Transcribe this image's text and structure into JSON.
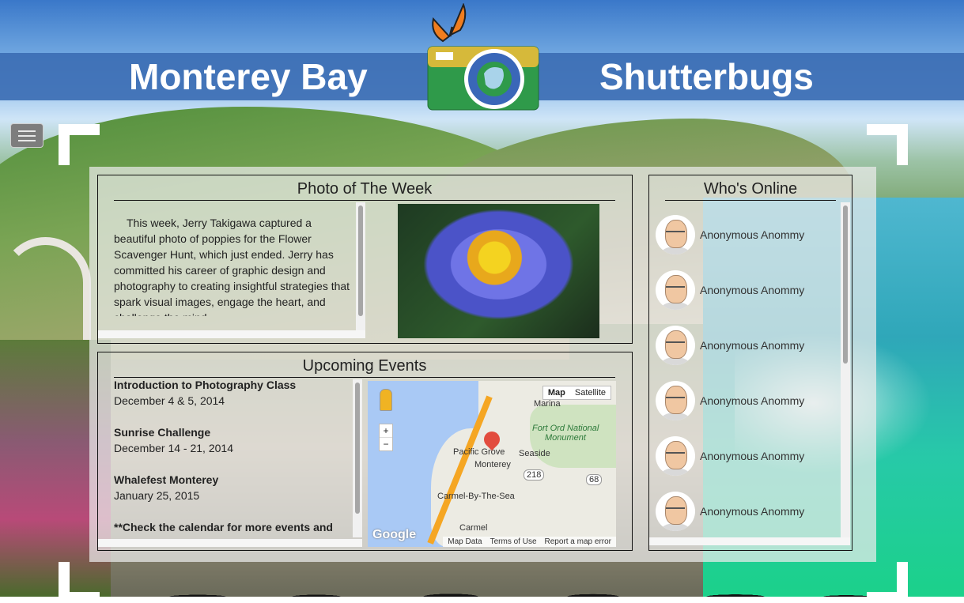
{
  "header": {
    "title_left": "Monterey Bay",
    "title_right": "Shutterbugs",
    "logo_icon": "camera-logo-icon",
    "mascot_icon": "butterfly-icon"
  },
  "nav": {
    "menu_icon": "hamburger-menu-icon"
  },
  "photo_of_week": {
    "heading": "Photo of The Week",
    "text": "This week, Jerry Takigawa captured a beautiful photo of poppies for the Flower Scavenger Hunt, which just ended. Jerry has committed his career of graphic design and photography to creating insightful strategies that spark visual images, engage the heart, and challenge the mind.",
    "image_subject": "water-lily-photo"
  },
  "events": {
    "heading": "Upcoming Events",
    "items": [
      {
        "title": "Introduction to Photography Class",
        "date": "December 4 & 5, 2014"
      },
      {
        "title": "Sunrise Challenge",
        "date": "December 14 - 21, 2014"
      },
      {
        "title": "Whalefest Monterey",
        "date": "January 25, 2015"
      }
    ],
    "note": "**Check the calendar for more events and"
  },
  "map": {
    "toggle_map": "Map",
    "toggle_satellite": "Satellite",
    "zoom_in": "+",
    "zoom_out": "−",
    "labels": {
      "marina": "Marina",
      "fort_ord": "Fort Ord National",
      "fort_ord2": "Monument",
      "pacific_grove": "Pacific Grove",
      "monterey": "Monterey",
      "seaside": "Seaside",
      "carmel_by_sea": "Carmel-By-The-Sea",
      "carmel": "Carmel",
      "route_218": "218",
      "route_68": "68"
    },
    "brand": "Google",
    "footer": {
      "data": "Map Data",
      "terms": "Terms of Use",
      "report": "Report a map error"
    }
  },
  "online": {
    "heading": "Who's Online",
    "users": [
      {
        "name": "Anonymous Anommy"
      },
      {
        "name": "Anonymous Anommy"
      },
      {
        "name": "Anonymous Anommy"
      },
      {
        "name": "Anonymous Anommy"
      },
      {
        "name": "Anonymous Anommy"
      },
      {
        "name": "Anonymous Anommy"
      }
    ]
  },
  "colors": {
    "banner": "#3c6eb4",
    "logo_green": "#2f9a4a",
    "logo_yellow": "#d6b93a",
    "butterfly": "#f07d1e"
  }
}
